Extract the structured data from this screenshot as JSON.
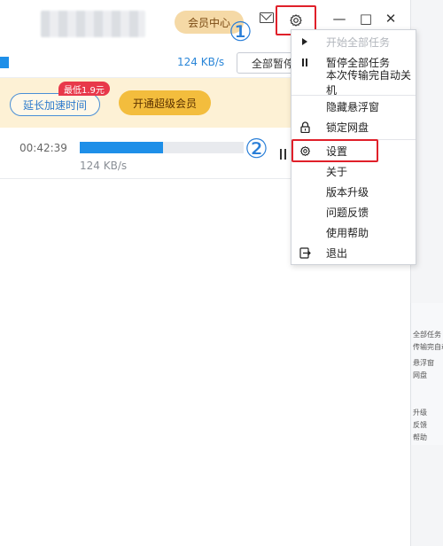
{
  "titlebar": {
    "vip_label": "会员中心",
    "minimize_glyph": "—",
    "maximize_glyph": "□",
    "close_glyph": "✕",
    "step1": "①",
    "step2": "②"
  },
  "transfer_row": {
    "speed": "124 KB/s",
    "pause_all_label": "全部暂停"
  },
  "promo": {
    "tag": "最低1.9元",
    "extend_label": "延长加速时间",
    "open_label": "开通超级会员"
  },
  "task": {
    "elapsed": "00:42:39",
    "speed": "124 KB/s",
    "progress": 0.51
  },
  "menu": {
    "items": [
      {
        "label": "开始全部任务",
        "icon": "play-icon",
        "disabled": true
      },
      {
        "label": "暂停全部任务",
        "icon": "pause-icon",
        "disabled": false
      },
      {
        "label": "本次传输完自动关机",
        "icon": "",
        "disabled": false
      },
      {
        "label": "隐藏悬浮窗",
        "icon": "",
        "disabled": false
      },
      {
        "label": "锁定网盘",
        "icon": "lock-icon",
        "disabled": false
      },
      {
        "label": "设置",
        "icon": "gear-icon",
        "disabled": false
      },
      {
        "label": "关于",
        "icon": "",
        "disabled": false
      },
      {
        "label": "版本升级",
        "icon": "",
        "disabled": false
      },
      {
        "label": "问题反馈",
        "icon": "",
        "disabled": false
      },
      {
        "label": "使用帮助",
        "icon": "",
        "disabled": false
      },
      {
        "label": "退出",
        "icon": "exit-icon",
        "disabled": false
      }
    ]
  },
  "echo": {
    "lines": [
      "全部任务",
      "传输完自动",
      "悬浮窗",
      "网盘",
      "升级",
      "反馈",
      "帮助"
    ]
  },
  "colors": {
    "accent_blue": "#1e8fe8",
    "highlight_red": "#e0202a",
    "vip_gold": "#f3bd3d",
    "promo_bg": "#fdf1d5"
  }
}
